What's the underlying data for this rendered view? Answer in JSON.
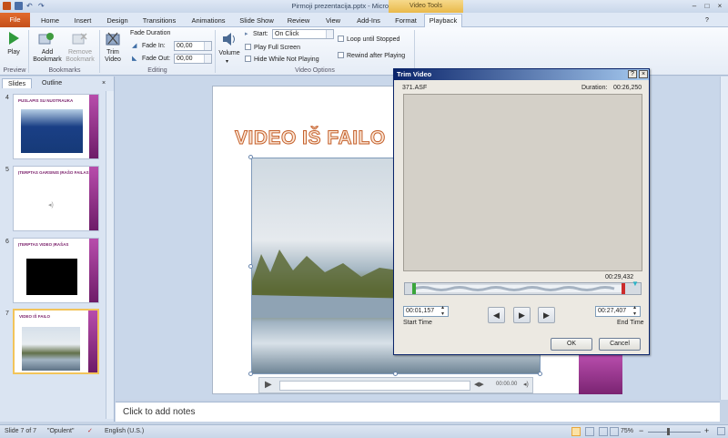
{
  "app": {
    "title": "Pirmoji prezentacija.pptx - Microsoft PowerPoint",
    "context_group": "Video Tools"
  },
  "tabs": {
    "file": "File",
    "items": [
      "Home",
      "Insert",
      "Design",
      "Transitions",
      "Animations",
      "Slide Show",
      "Review",
      "View",
      "Add-Ins",
      "Format",
      "Playback"
    ],
    "active": "Playback"
  },
  "ribbon": {
    "play": "Play",
    "add_bookmark": "Add\nBookmark",
    "remove_bookmark": "Remove\nBookmark",
    "trim_video": "Trim\nVideo",
    "fade_duration": "Fade Duration",
    "fade_in_label": "Fade In:",
    "fade_in_value": "00,00",
    "fade_out_label": "Fade Out:",
    "fade_out_value": "00,00",
    "volume": "Volume",
    "start_label": "Start:",
    "start_value": "On Click",
    "play_full_screen": "Play Full Screen",
    "hide_while_not_playing": "Hide While Not Playing",
    "loop": "Loop until Stopped",
    "rewind": "Rewind after Playing",
    "groups": {
      "preview": "Preview",
      "bookmarks": "Bookmarks",
      "editing": "Editing",
      "video_options": "Video Options"
    }
  },
  "left_pane": {
    "tabs": [
      "Slides",
      "Outline"
    ],
    "slides": [
      {
        "num": "4",
        "title": "PUSLAPIS SU NUOTRAUKA"
      },
      {
        "num": "5",
        "title": "ĮTERPTAS GARSINIS ĮRAŠO FAILAS"
      },
      {
        "num": "6",
        "title": "ĮTERPTAS VIDEO ĮRAŠAS"
      },
      {
        "num": "7",
        "title": "VIDEO IŠ FAILO"
      }
    ]
  },
  "slide": {
    "title": "VIDEO IŠ FAILO",
    "video_time": "00:00.00"
  },
  "notes_placeholder": "Click to add notes",
  "status": {
    "slide": "Slide 7 of 7",
    "theme": "\"Opulent\"",
    "language": "English (U.S.)",
    "zoom": "75%"
  },
  "dialog": {
    "title": "Trim Video",
    "help": "?",
    "close": "×",
    "filename": "371.ASF",
    "duration_label": "Duration:",
    "duration_value": "00:26,250",
    "end_marker": "00:29,432",
    "start_time_value": "00:01,157",
    "start_time_label": "Start Time",
    "end_time_value": "00:27,407",
    "end_time_label": "End Time",
    "ok": "OK",
    "cancel": "Cancel",
    "track_start_fraction": 0.03,
    "track_end_fraction": 0.92
  },
  "colors": {
    "file_tab": "#c4501a",
    "accent_purple": "#7a2472",
    "dialog_title": "#0a246a"
  }
}
